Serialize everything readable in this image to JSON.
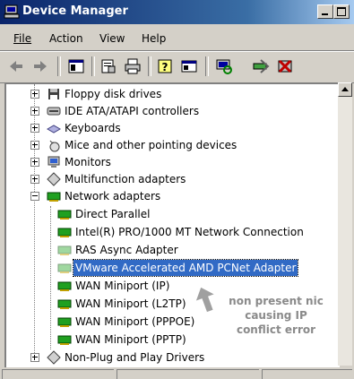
{
  "window": {
    "title": "Device Manager",
    "controls": [
      "minimize",
      "maximize"
    ]
  },
  "menu": [
    {
      "label": "File",
      "accel": "F"
    },
    {
      "label": "Action",
      "accel": "A"
    },
    {
      "label": "View",
      "accel": "V"
    },
    {
      "label": "Help",
      "accel": "H"
    }
  ],
  "toolbar": {
    "buttons": [
      "back-icon",
      "forward-icon",
      "up-icon",
      "properties-icon",
      "print-icon",
      "help-icon",
      "console-icon",
      "monitor-icon",
      "scan-icon",
      "uninstall-icon"
    ]
  },
  "tree": {
    "items": [
      {
        "label": "Floppy disk drives",
        "icon": "floppy-icon",
        "expander": "plus"
      },
      {
        "label": "IDE ATA/ATAPI controllers",
        "icon": "ide-icon",
        "expander": "plus"
      },
      {
        "label": "Keyboards",
        "icon": "keyboard-icon",
        "expander": "plus"
      },
      {
        "label": "Mice and other pointing devices",
        "icon": "mouse-icon",
        "expander": "plus"
      },
      {
        "label": "Monitors",
        "icon": "monitor-icon",
        "expander": "plus"
      },
      {
        "label": "Multifunction adapters",
        "icon": "multifunction-icon",
        "expander": "plus"
      },
      {
        "label": "Network adapters",
        "icon": "network-card-icon",
        "expander": "minus"
      },
      {
        "label": "Direct Parallel",
        "icon": "network-card-icon",
        "child": true
      },
      {
        "label": "Intel(R) PRO/1000 MT Network Connection",
        "icon": "network-card-icon",
        "child": true
      },
      {
        "label": "RAS Async Adapter",
        "icon": "network-card-icon",
        "child": true,
        "ghost": true
      },
      {
        "label": "VMware Accelerated AMD PCNet Adapter",
        "icon": "network-card-icon",
        "child": true,
        "ghost": true,
        "selected": true
      },
      {
        "label": "WAN Miniport (IP)",
        "icon": "network-card-icon",
        "child": true
      },
      {
        "label": "WAN Miniport (L2TP)",
        "icon": "network-card-icon",
        "child": true
      },
      {
        "label": "WAN Miniport (PPPOE)",
        "icon": "network-card-icon",
        "child": true
      },
      {
        "label": "WAN Miniport (PPTP)",
        "icon": "network-card-icon",
        "child": true
      },
      {
        "label": "Non-Plug and Play Drivers",
        "icon": "driver-icon",
        "expander": "plus"
      }
    ]
  },
  "annotation": {
    "line1": "non present nic",
    "line2": "causing IP",
    "line3": "conflict error"
  },
  "colors": {
    "selection": "#316ac5",
    "titlebar": "#0a246a",
    "annotation": "#8a8a8a"
  }
}
